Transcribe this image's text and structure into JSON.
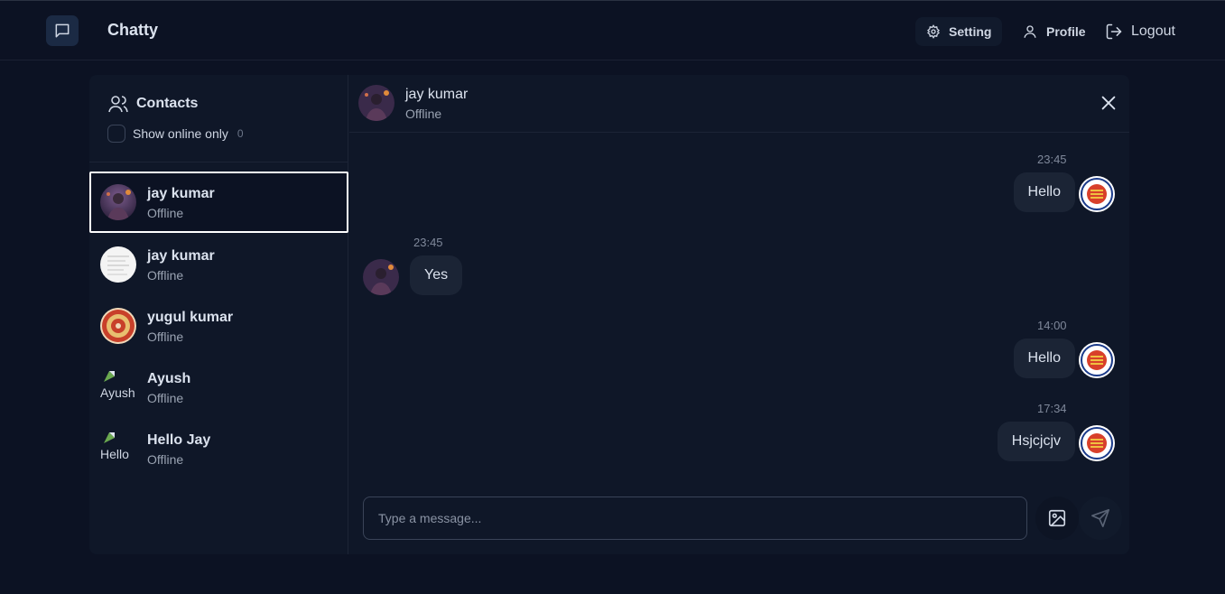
{
  "nav": {
    "app_title": "Chatty",
    "setting_label": "Setting",
    "profile_label": "Profile",
    "logout_label": "Logout"
  },
  "sidebar": {
    "title": "Contacts",
    "filter_label": "Show online only",
    "online_count": "0",
    "contacts": [
      {
        "name": "jay kumar",
        "status": "Offline",
        "avatar": "photo-avatar"
      },
      {
        "name": "jay kumar",
        "status": "Offline",
        "avatar": "document-avatar"
      },
      {
        "name": "yugul kumar",
        "status": "Offline",
        "avatar": "seal-avatar"
      },
      {
        "name": "Ayush",
        "status": "Offline",
        "avatar": "broken-image",
        "alt": "Ayush"
      },
      {
        "name": "Hello Jay",
        "status": "Offline",
        "avatar": "broken-image",
        "alt": "Hello"
      }
    ]
  },
  "chat": {
    "header": {
      "name": "jay kumar",
      "status": "Offline"
    },
    "messages": [
      {
        "time": "23:45",
        "text": "Hello",
        "side": "sent"
      },
      {
        "time": "23:45",
        "text": "Yes",
        "side": "received"
      },
      {
        "time": "14:00",
        "text": "Hello",
        "side": "sent"
      },
      {
        "time": "17:34",
        "text": "Hsjcjcjv",
        "side": "sent"
      }
    ],
    "input_placeholder": "Type a message..."
  },
  "colors": {
    "background": "#0c1223",
    "panel": "#0f1728",
    "bubble": "#1b2435",
    "accent": "#1b2a44"
  }
}
